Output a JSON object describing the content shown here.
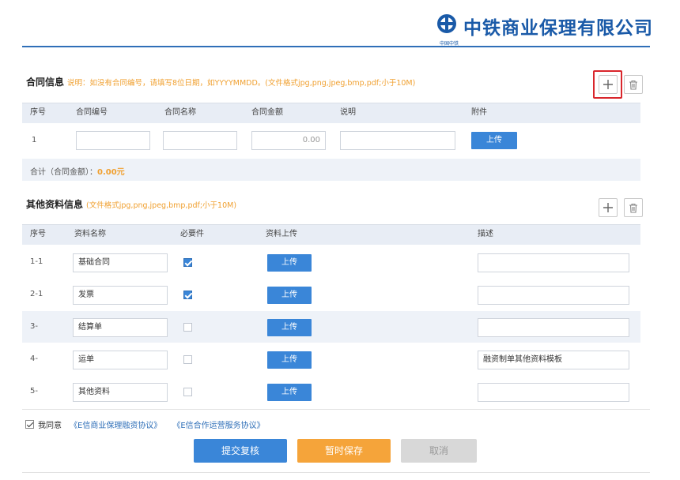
{
  "header": {
    "company": "中铁商业保理有限公司",
    "emblem_sub": "中国中铁",
    "brand_color": "#1a5aa8"
  },
  "contract": {
    "title": "合同信息",
    "note": "说明：如没有合同编号，请填写8位日期，如YYYYMMDD。(文件格式jpg,png,jpeg,bmp,pdf;小于10M)",
    "columns": [
      "序号",
      "合同编号",
      "合同名称",
      "合同金额",
      "说明",
      "附件"
    ],
    "rows": [
      {
        "index": "1",
        "number": "",
        "name": "",
        "amount": "0.00",
        "desc": "",
        "upload": "上传"
      }
    ],
    "total_label": "合计（合同金额）：",
    "total_value": "0.00元"
  },
  "other": {
    "title": "其他资料信息",
    "note": "(文件格式jpg,png,jpeg,bmp,pdf;小于10M)",
    "columns": [
      "序号",
      "资料名称",
      "必要件",
      "资料上传",
      "描述"
    ],
    "rows": [
      {
        "index": "1-1",
        "name": "基础合同",
        "required": true,
        "upload": "上传",
        "desc": ""
      },
      {
        "index": "2-1",
        "name": "发票",
        "required": true,
        "upload": "上传",
        "desc": ""
      },
      {
        "index": "3-",
        "name": "结算单",
        "required": false,
        "upload": "上传",
        "desc": ""
      },
      {
        "index": "4-",
        "name": "运单",
        "required": false,
        "upload": "上传",
        "desc": "融资制单其他资料模板"
      },
      {
        "index": "5-",
        "name": "其他资料",
        "required": false,
        "upload": "上传",
        "desc": ""
      }
    ]
  },
  "agree": {
    "label": "我同意",
    "link1": "《E信商业保理融资协议》",
    "link2": "《E信合作运营服务协议》"
  },
  "actions": {
    "submit": "提交复核",
    "save": "暂时保存",
    "cancel": "取消"
  },
  "icons": {
    "add": "plus-icon",
    "delete": "trash-icon"
  }
}
